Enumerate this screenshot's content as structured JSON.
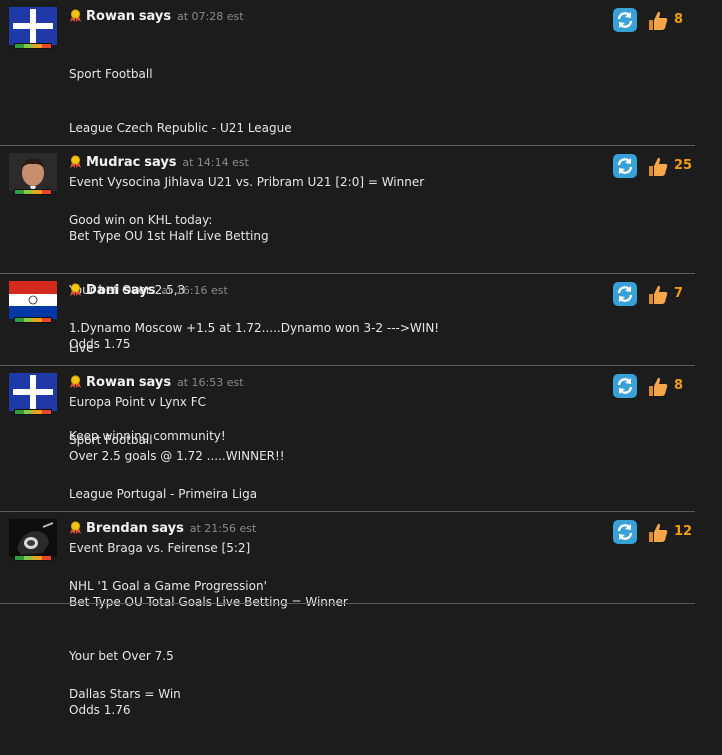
{
  "posts": [
    {
      "author": "Rowan",
      "says": "says",
      "time": "at 07:28 est",
      "likes": "8",
      "avatar_icon": "eureka-flag-icon",
      "lines": [
        "Sport Football",
        "League Czech Republic - U21 League",
        "Event Vysocina Jihlava U21 vs. Pribram U21 [2:0] = Winner",
        "Bet Type OU 1st Half Live Betting",
        "Your bet Over 2.5,3",
        "Odds 1.75"
      ]
    },
    {
      "author": "Mudrac",
      "says": "says",
      "time": "at 14:14 est",
      "likes": "25",
      "avatar_icon": "man-portrait-photo-icon",
      "lines": [
        "Good win on KHL today:",
        "",
        "1.Dynamo Moscow +1.5 at 1.72.....Dynamo won 3-2 --->WIN!",
        "",
        "Keep winning community!"
      ]
    },
    {
      "author": "Dani",
      "says": "says",
      "time": "at 16:16 est",
      "likes": "7",
      "avatar_icon": "paraguay-flag-icon",
      "lines": [
        "Live",
        "Europa Point v Lynx FC",
        "Over 2.5 goals @ 1.72 .....WINNER!!"
      ]
    },
    {
      "author": "Rowan",
      "says": "says",
      "time": "at 16:53 est",
      "likes": "8",
      "avatar_icon": "eureka-flag-icon",
      "lines": [
        "Sport Football",
        "League Portugal - Primeira Liga",
        "Event Braga vs. Feirense [5:2]",
        "Bet Type OU Total Goals Live Betting = Winner",
        "Your bet Over 7.5",
        "Odds 1.76"
      ]
    },
    {
      "author": "Brendan",
      "says": "says",
      "time": "at 21:56 est",
      "likes": "12",
      "avatar_icon": "hockey-player-photo-icon",
      "lines": [
        "NHL '1 Goal a Game Progression'",
        "",
        "Dallas Stars = Win"
      ]
    }
  ],
  "colors": {
    "background": "#1c1c1c",
    "likes_count": "#f39c12",
    "refresh_icon": "#3aa0d8",
    "thumb_icon": "#f5a54a",
    "meter": [
      "#2e9e3a",
      "#8cc63f",
      "#f0a020",
      "#e8452a"
    ]
  }
}
